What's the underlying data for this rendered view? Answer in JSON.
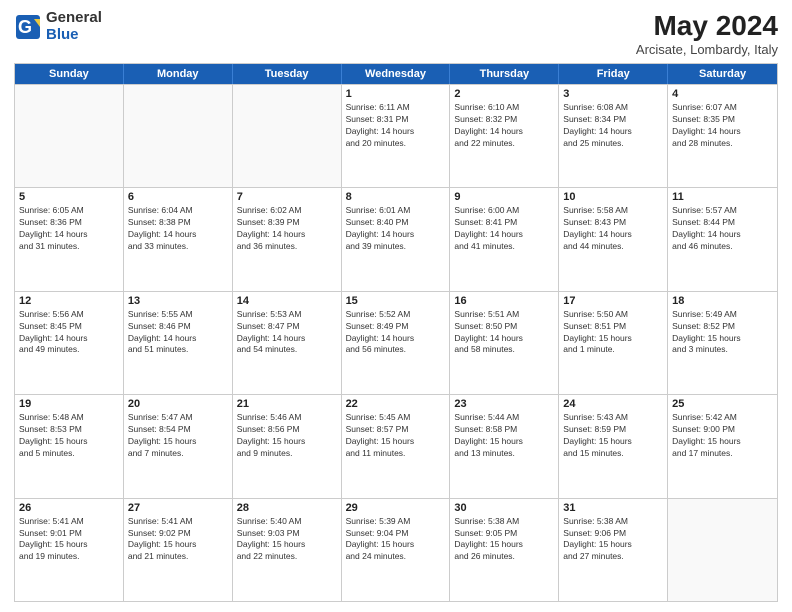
{
  "logo": {
    "general": "General",
    "blue": "Blue"
  },
  "title": "May 2024",
  "subtitle": "Arcisate, Lombardy, Italy",
  "header_days": [
    "Sunday",
    "Monday",
    "Tuesday",
    "Wednesday",
    "Thursday",
    "Friday",
    "Saturday"
  ],
  "weeks": [
    [
      {
        "day": "",
        "info": ""
      },
      {
        "day": "",
        "info": ""
      },
      {
        "day": "",
        "info": ""
      },
      {
        "day": "1",
        "info": "Sunrise: 6:11 AM\nSunset: 8:31 PM\nDaylight: 14 hours\nand 20 minutes."
      },
      {
        "day": "2",
        "info": "Sunrise: 6:10 AM\nSunset: 8:32 PM\nDaylight: 14 hours\nand 22 minutes."
      },
      {
        "day": "3",
        "info": "Sunrise: 6:08 AM\nSunset: 8:34 PM\nDaylight: 14 hours\nand 25 minutes."
      },
      {
        "day": "4",
        "info": "Sunrise: 6:07 AM\nSunset: 8:35 PM\nDaylight: 14 hours\nand 28 minutes."
      }
    ],
    [
      {
        "day": "5",
        "info": "Sunrise: 6:05 AM\nSunset: 8:36 PM\nDaylight: 14 hours\nand 31 minutes."
      },
      {
        "day": "6",
        "info": "Sunrise: 6:04 AM\nSunset: 8:38 PM\nDaylight: 14 hours\nand 33 minutes."
      },
      {
        "day": "7",
        "info": "Sunrise: 6:02 AM\nSunset: 8:39 PM\nDaylight: 14 hours\nand 36 minutes."
      },
      {
        "day": "8",
        "info": "Sunrise: 6:01 AM\nSunset: 8:40 PM\nDaylight: 14 hours\nand 39 minutes."
      },
      {
        "day": "9",
        "info": "Sunrise: 6:00 AM\nSunset: 8:41 PM\nDaylight: 14 hours\nand 41 minutes."
      },
      {
        "day": "10",
        "info": "Sunrise: 5:58 AM\nSunset: 8:43 PM\nDaylight: 14 hours\nand 44 minutes."
      },
      {
        "day": "11",
        "info": "Sunrise: 5:57 AM\nSunset: 8:44 PM\nDaylight: 14 hours\nand 46 minutes."
      }
    ],
    [
      {
        "day": "12",
        "info": "Sunrise: 5:56 AM\nSunset: 8:45 PM\nDaylight: 14 hours\nand 49 minutes."
      },
      {
        "day": "13",
        "info": "Sunrise: 5:55 AM\nSunset: 8:46 PM\nDaylight: 14 hours\nand 51 minutes."
      },
      {
        "day": "14",
        "info": "Sunrise: 5:53 AM\nSunset: 8:47 PM\nDaylight: 14 hours\nand 54 minutes."
      },
      {
        "day": "15",
        "info": "Sunrise: 5:52 AM\nSunset: 8:49 PM\nDaylight: 14 hours\nand 56 minutes."
      },
      {
        "day": "16",
        "info": "Sunrise: 5:51 AM\nSunset: 8:50 PM\nDaylight: 14 hours\nand 58 minutes."
      },
      {
        "day": "17",
        "info": "Sunrise: 5:50 AM\nSunset: 8:51 PM\nDaylight: 15 hours\nand 1 minute."
      },
      {
        "day": "18",
        "info": "Sunrise: 5:49 AM\nSunset: 8:52 PM\nDaylight: 15 hours\nand 3 minutes."
      }
    ],
    [
      {
        "day": "19",
        "info": "Sunrise: 5:48 AM\nSunset: 8:53 PM\nDaylight: 15 hours\nand 5 minutes."
      },
      {
        "day": "20",
        "info": "Sunrise: 5:47 AM\nSunset: 8:54 PM\nDaylight: 15 hours\nand 7 minutes."
      },
      {
        "day": "21",
        "info": "Sunrise: 5:46 AM\nSunset: 8:56 PM\nDaylight: 15 hours\nand 9 minutes."
      },
      {
        "day": "22",
        "info": "Sunrise: 5:45 AM\nSunset: 8:57 PM\nDaylight: 15 hours\nand 11 minutes."
      },
      {
        "day": "23",
        "info": "Sunrise: 5:44 AM\nSunset: 8:58 PM\nDaylight: 15 hours\nand 13 minutes."
      },
      {
        "day": "24",
        "info": "Sunrise: 5:43 AM\nSunset: 8:59 PM\nDaylight: 15 hours\nand 15 minutes."
      },
      {
        "day": "25",
        "info": "Sunrise: 5:42 AM\nSunset: 9:00 PM\nDaylight: 15 hours\nand 17 minutes."
      }
    ],
    [
      {
        "day": "26",
        "info": "Sunrise: 5:41 AM\nSunset: 9:01 PM\nDaylight: 15 hours\nand 19 minutes."
      },
      {
        "day": "27",
        "info": "Sunrise: 5:41 AM\nSunset: 9:02 PM\nDaylight: 15 hours\nand 21 minutes."
      },
      {
        "day": "28",
        "info": "Sunrise: 5:40 AM\nSunset: 9:03 PM\nDaylight: 15 hours\nand 22 minutes."
      },
      {
        "day": "29",
        "info": "Sunrise: 5:39 AM\nSunset: 9:04 PM\nDaylight: 15 hours\nand 24 minutes."
      },
      {
        "day": "30",
        "info": "Sunrise: 5:38 AM\nSunset: 9:05 PM\nDaylight: 15 hours\nand 26 minutes."
      },
      {
        "day": "31",
        "info": "Sunrise: 5:38 AM\nSunset: 9:06 PM\nDaylight: 15 hours\nand 27 minutes."
      },
      {
        "day": "",
        "info": ""
      }
    ]
  ]
}
